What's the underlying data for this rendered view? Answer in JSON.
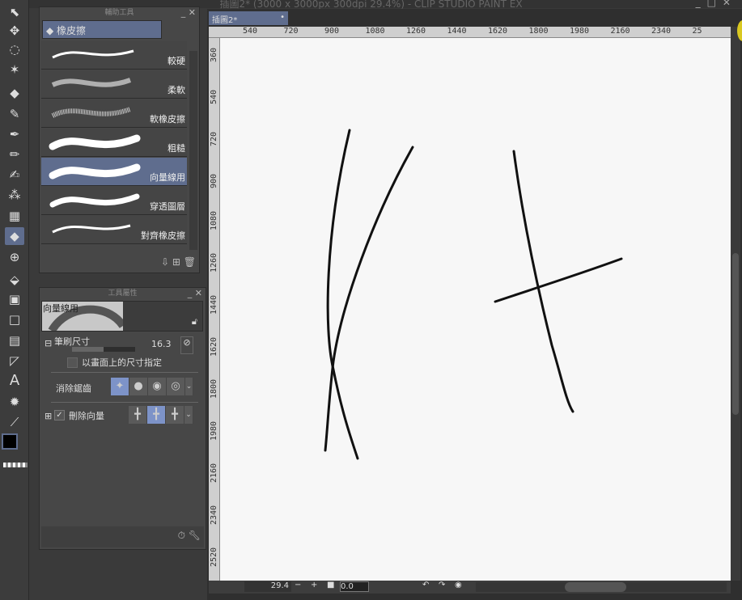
{
  "window": {
    "title": "插圖2* (3000 x 3000px 300dpi 29.4%) - CLIP STUDIO PAINT EX"
  },
  "subtool_panel": {
    "title": "輔助工具",
    "group": "橡皮擦",
    "items": [
      {
        "label": "較硬"
      },
      {
        "label": "柔軟"
      },
      {
        "label": "軟橡皮擦"
      },
      {
        "label": "粗糙"
      },
      {
        "label": "向量線用",
        "selected": true
      },
      {
        "label": "穿透圖層"
      },
      {
        "label": "對齊橡皮擦"
      }
    ]
  },
  "tool_property": {
    "title": "工具屬性",
    "preview_label": "向量線用",
    "brush_size_label": "筆刷尺寸",
    "brush_size": "16.3",
    "brush_size_fraction": 0.3,
    "screen_size_label": "以畫面上的尺寸指定",
    "screen_size_checked": false,
    "antialias_label": "消除鋸齒",
    "antialias_selected": 0,
    "erase_vector_label": "刪除向量",
    "erase_vector_checked": true,
    "erase_vector_selected": 1
  },
  "document": {
    "tab_label": "插圖2*",
    "h_ruler": [
      "540",
      "720",
      "900",
      "1080",
      "1260",
      "1440",
      "1620",
      "1800",
      "1980",
      "2160",
      "2340",
      "25"
    ],
    "v_ruler": [
      "360",
      "540",
      "720",
      "900",
      "1080",
      "1260",
      "1440",
      "1620",
      "1800",
      "1980",
      "2160",
      "2340",
      "2520"
    ]
  },
  "status": {
    "zoom": "29.4",
    "rotation": "0.0"
  },
  "colors": {
    "accent": "#5f6d8e",
    "main_color": "#000000",
    "sub_color": "#ffffff"
  }
}
